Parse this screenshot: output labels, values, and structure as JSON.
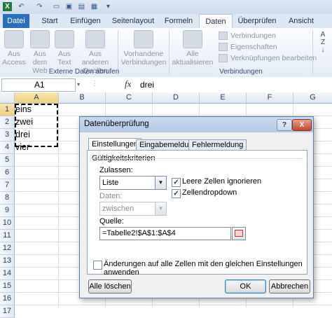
{
  "app": {
    "file_icon": "excel-icon"
  },
  "tabs": [
    {
      "label": "Datei"
    },
    {
      "label": "Start"
    },
    {
      "label": "Einfügen"
    },
    {
      "label": "Seitenlayout"
    },
    {
      "label": "Formeln"
    },
    {
      "label": "Daten"
    },
    {
      "label": "Überprüfen"
    },
    {
      "label": "Ansicht"
    }
  ],
  "active_tab": "Daten",
  "ribbon": {
    "external": {
      "access": "Aus Access",
      "web": "Aus dem Web",
      "text": "Aus Text",
      "other": "Aus anderen Quellen",
      "existing": "Vorhandene Verbindungen",
      "group_label": "Externe Daten abrufen"
    },
    "connections": {
      "refresh": "Alle aktualisieren",
      "connections": "Verbindungen",
      "properties": "Eigenschaften",
      "edit_links": "Verknüpfungen bearbeiten",
      "group_label": "Verbindungen"
    }
  },
  "formula_bar": {
    "name_box": "A1",
    "fx": "fx",
    "value": "drei"
  },
  "columns": [
    "A",
    "B",
    "C",
    "D",
    "E",
    "F",
    "G"
  ],
  "rows": [
    "1",
    "2",
    "3",
    "4",
    "5",
    "6",
    "7",
    "8",
    "9",
    "10",
    "11",
    "12",
    "13",
    "14",
    "15",
    "16",
    "17"
  ],
  "cells": {
    "A1": "eins",
    "A2": "zwei",
    "A3": "drei",
    "A4": "vier"
  },
  "dialog": {
    "title": "Datenüberprüfung",
    "help": "?",
    "close": "X",
    "tabs": [
      "Einstellungen",
      "Eingabemeldung",
      "Fehlermeldung"
    ],
    "active_tab": "Einstellungen",
    "section": "Gültigkeitskriterien",
    "allow_label": "Zulassen:",
    "allow_value": "Liste",
    "data_label": "Daten:",
    "data_value": "zwischen",
    "ignore_blank": {
      "label": "Leere Zellen ignorieren",
      "checked": true
    },
    "in_cell_dropdown": {
      "label": "Zellendropdown",
      "checked": true
    },
    "source_label": "Quelle:",
    "source_value": "=Tabelle2!$A$1:$A$4",
    "apply_all": {
      "label": "Änderungen auf alle Zellen mit den gleichen Einstellungen anwenden",
      "checked": false
    },
    "clear_all": "Alle löschen",
    "ok": "OK",
    "cancel": "Abbrechen"
  }
}
